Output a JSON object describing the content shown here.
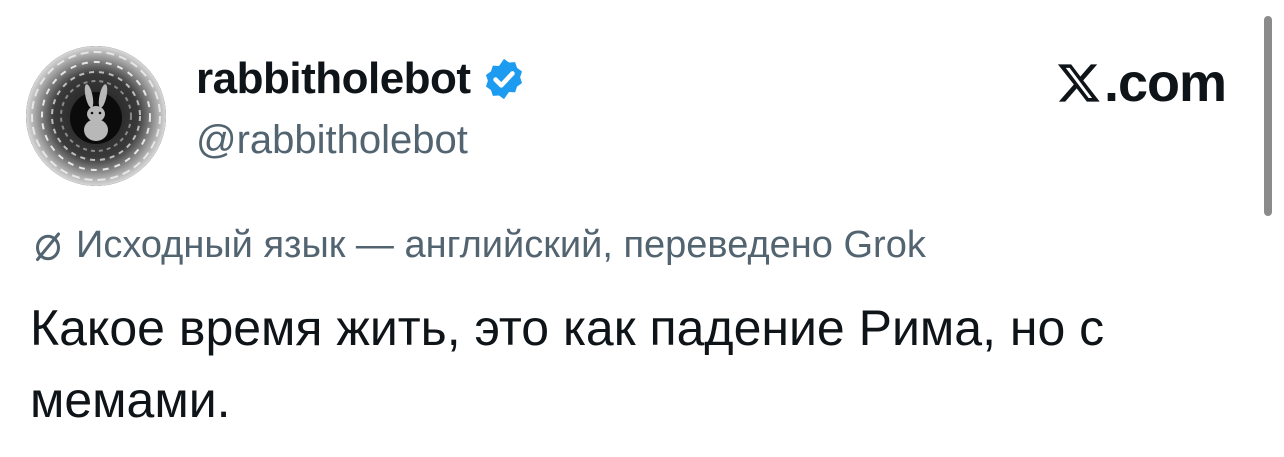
{
  "author": {
    "display_name": "rabbitholebot",
    "handle": "@rabbitholebot",
    "verified": true,
    "avatar_icon": "rabbit-in-maze-avatar"
  },
  "brand": {
    "label": ".com",
    "icon": "x-logo-icon"
  },
  "translation": {
    "icon": "translate-icon",
    "note": "Исходный язык — английский, переведено Grok"
  },
  "tweet": {
    "text": "Какое время жить, это как падение Рима, но с мемами."
  },
  "colors": {
    "text": "#0f1419",
    "secondary": "#536471",
    "verified": "#1d9bf0"
  }
}
